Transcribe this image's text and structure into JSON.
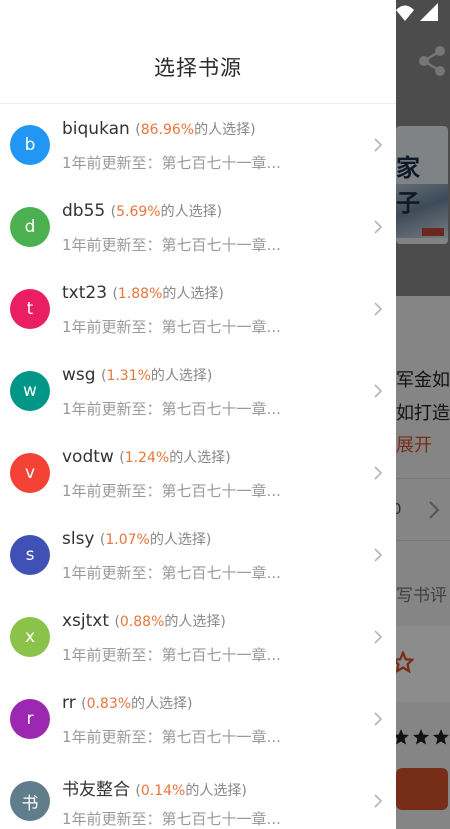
{
  "drawer": {
    "title": "选择书源",
    "sources": [
      {
        "letter": "b",
        "name": "biqukan",
        "pct": "86.96%",
        "suffix": "的人选择",
        "update": "1年前更新至：第七百七十一章...",
        "color": "#2196f3"
      },
      {
        "letter": "d",
        "name": "db55",
        "pct": "5.69%",
        "suffix": "的人选择",
        "update": "1年前更新至：第七百七十一章...",
        "color": "#4caf50"
      },
      {
        "letter": "t",
        "name": "txt23",
        "pct": "1.88%",
        "suffix": "的人选择",
        "update": "1年前更新至：第七百七十一章...",
        "color": "#e91e63"
      },
      {
        "letter": "w",
        "name": "wsg",
        "pct": "1.31%",
        "suffix": "的人选择",
        "update": "1年前更新至：第七百七十一章...",
        "color": "#009688"
      },
      {
        "letter": "v",
        "name": "vodtw",
        "pct": "1.24%",
        "suffix": "的人选择",
        "update": "1年前更新至：第七百七十一章...",
        "color": "#f44336"
      },
      {
        "letter": "s",
        "name": "slsy",
        "pct": "1.07%",
        "suffix": "的人选择",
        "update": "1年前更新至：第七百七十一章...",
        "color": "#3f51b5"
      },
      {
        "letter": "x",
        "name": "xsjtxt",
        "pct": "0.88%",
        "suffix": "的人选择",
        "update": "1年前更新至：第七百七十一章...",
        "color": "#8bc34a"
      },
      {
        "letter": "r",
        "name": "rr",
        "pct": "0.83%",
        "suffix": "的人选择",
        "update": "1年前更新至：第七百七十一章...",
        "color": "#9c27b0"
      },
      {
        "letter": "书",
        "name": "书友整合",
        "pct": "0.14%",
        "suffix": "的人选择",
        "update": "1年前更新至：第七百七十一章...",
        "color": "#607d8b"
      }
    ]
  },
  "background": {
    "desc_line1": "军金如",
    "desc_line2": "如打造",
    "expand": "展开",
    "row_value": "0",
    "review": "写书评",
    "cover_text": "家子"
  },
  "colors": {
    "accent": "#e8753a",
    "brand": "#d9542c"
  }
}
